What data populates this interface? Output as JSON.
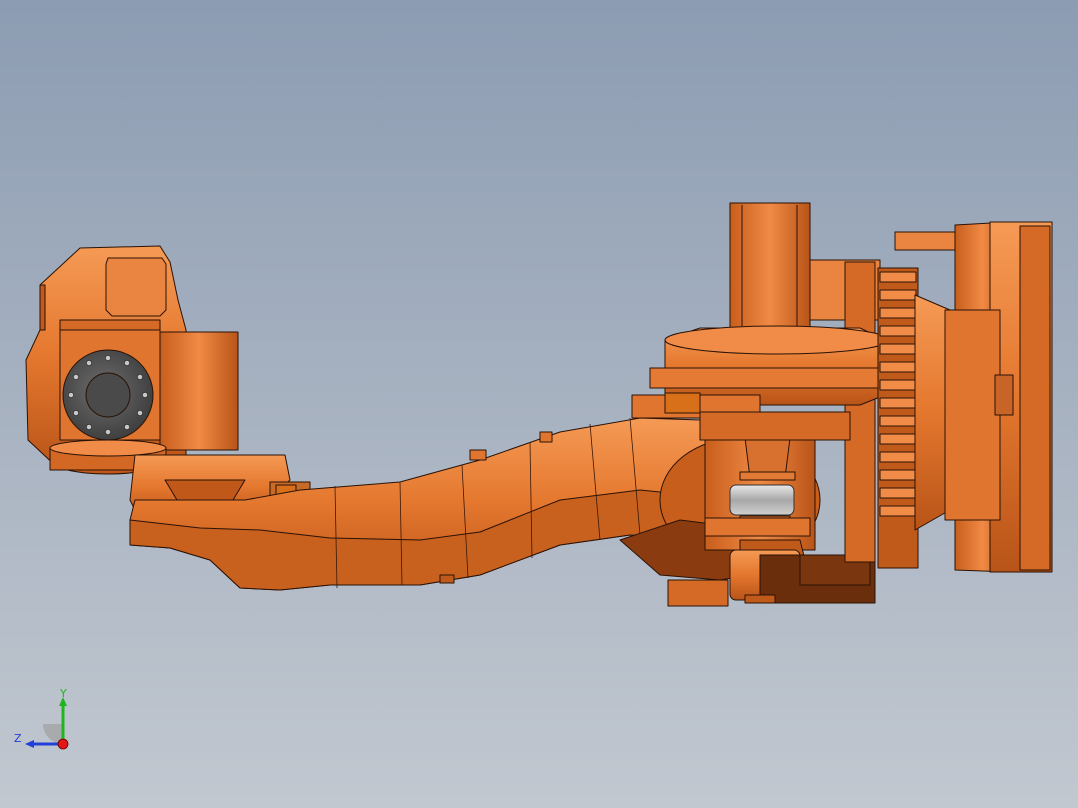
{
  "viewport": {
    "background_top": "#8c9cb2",
    "background_bottom": "#c2c8d0"
  },
  "model": {
    "part_color": "#e4772e",
    "part_shade": "#b85418",
    "part_highlight": "#f59a55",
    "edge_color": "#2a1206",
    "flange_color": "#5a5a5a"
  },
  "triad": {
    "y_label": "Y",
    "z_label": "Z",
    "y_color": "#1fb51f",
    "z_color": "#2140d8",
    "x_color": "#e01818"
  }
}
